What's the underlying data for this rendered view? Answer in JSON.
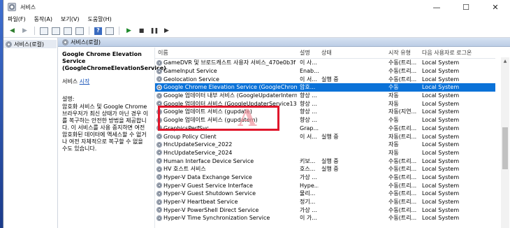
{
  "window": {
    "title": "서비스",
    "controls": [
      "—",
      "☐",
      "✕"
    ]
  },
  "menu": [
    "파일(F)",
    "동작(A)",
    "보기(V)",
    "도움말(H)"
  ],
  "tree": {
    "item": "서비스(로컬)"
  },
  "tab": {
    "label": "서비스(로컬)"
  },
  "details": {
    "service_name": "Google Chrome Elevation Service (GoogleChromeElevationService)",
    "start_prefix": "서비스 ",
    "start_link": "시작",
    "desc_label": "설명:",
    "desc_text": "암호화 서비스 및 Google Chrome 브라우저가 최신 상태가 아닌 경우 이를 복구하는 안전한 방법을 제공합니다. 이 서비스를 사용 중지하면 여전 암호화된 데이터에 액세스할 수 없거나 여전 자체적으로 복구할 수 없을 수도 있습니다."
  },
  "list": {
    "columns": {
      "name": "이름",
      "desc": "설명",
      "status": "상태",
      "start": "시작 유형",
      "logon": "다음 사용자로 로그온"
    },
    "rows": [
      {
        "name": "GameDVR 및 브로드캐스트 사용자 서비스_470e0b3f",
        "desc": "이 사...",
        "status": "",
        "start": "수동(트리...",
        "logon": "Local System"
      },
      {
        "name": "GameInput Service",
        "desc": "Enab...",
        "status": "",
        "start": "수동(트리...",
        "logon": "Local System"
      },
      {
        "name": "Geolocation Service",
        "desc": "이 서...",
        "status": "실행 중",
        "start": "수동(트리...",
        "logon": "Local System"
      },
      {
        "name": "Google Chrome Elevation Service (GoogleChromeElev...",
        "desc": "암호...",
        "status": "",
        "start": "수동",
        "logon": "Local System"
      },
      {
        "name": "Google 업데이터 내부 서비스 (GoogleUpdaterInternal...",
        "desc": "향상 ...",
        "status": "",
        "start": "자동",
        "logon": "Local System"
      },
      {
        "name": "Google 업데이터 서비스 (GoogleUpdaterService137.0...",
        "desc": "향상 ...",
        "status": "",
        "start": "자동",
        "logon": "Local System"
      },
      {
        "name": "Google 업데이트 서비스 (gupdate)",
        "desc": "향상 ...",
        "status": "",
        "start": "자동(지연...",
        "logon": "Local System"
      },
      {
        "name": "Google 업데이트 서비스 (gupdatem)",
        "desc": "향상 ...",
        "status": "",
        "start": "수동",
        "logon": "Local System"
      },
      {
        "name": "GraphicsPerfSvc",
        "desc": "Grap...",
        "status": "",
        "start": "수동(트리...",
        "logon": "Local System"
      },
      {
        "name": "Group Policy Client",
        "desc": "이 서...",
        "status": "실행 중",
        "start": "자동(트리...",
        "logon": "Local System"
      },
      {
        "name": "HncUpdateService_2022",
        "desc": "",
        "status": "",
        "start": "자동",
        "logon": "Local System"
      },
      {
        "name": "HncUpdateService_2024",
        "desc": "",
        "status": "",
        "start": "자동",
        "logon": "Local System"
      },
      {
        "name": "Human Interface Device Service",
        "desc": "키보...",
        "status": "실행 중",
        "start": "수동(트리...",
        "logon": "Local System"
      },
      {
        "name": "HV 호스트 서비스",
        "desc": "호스...",
        "status": "실행 중",
        "start": "수동(트리...",
        "logon": "Local System"
      },
      {
        "name": "Hyper-V Data Exchange Service",
        "desc": "가상 ...",
        "status": "",
        "start": "수동(트리...",
        "logon": "Local System"
      },
      {
        "name": "Hyper-V Guest Service Interface",
        "desc": "Hype...",
        "status": "",
        "start": "수동(트리...",
        "logon": "Local System"
      },
      {
        "name": "Hyper-V Guest Shutdown Service",
        "desc": "물리...",
        "status": "",
        "start": "수동(트리...",
        "logon": "Local System"
      },
      {
        "name": "Hyper-V Heartbeat Service",
        "desc": "정기...",
        "status": "",
        "start": "수동(트리...",
        "logon": "Local System"
      },
      {
        "name": "Hyper-V PowerShell Direct Service",
        "desc": "가상 ...",
        "status": "",
        "start": "수동(트리...",
        "logon": "Local System"
      },
      {
        "name": "Hyper-V Time Synchronization Service",
        "desc": "이 가...",
        "status": "",
        "start": "수동(트리...",
        "logon": "Local System"
      }
    ]
  },
  "watermark": "A",
  "colors": {
    "selection": "#0b72d8",
    "highlight": "#e0162b"
  }
}
